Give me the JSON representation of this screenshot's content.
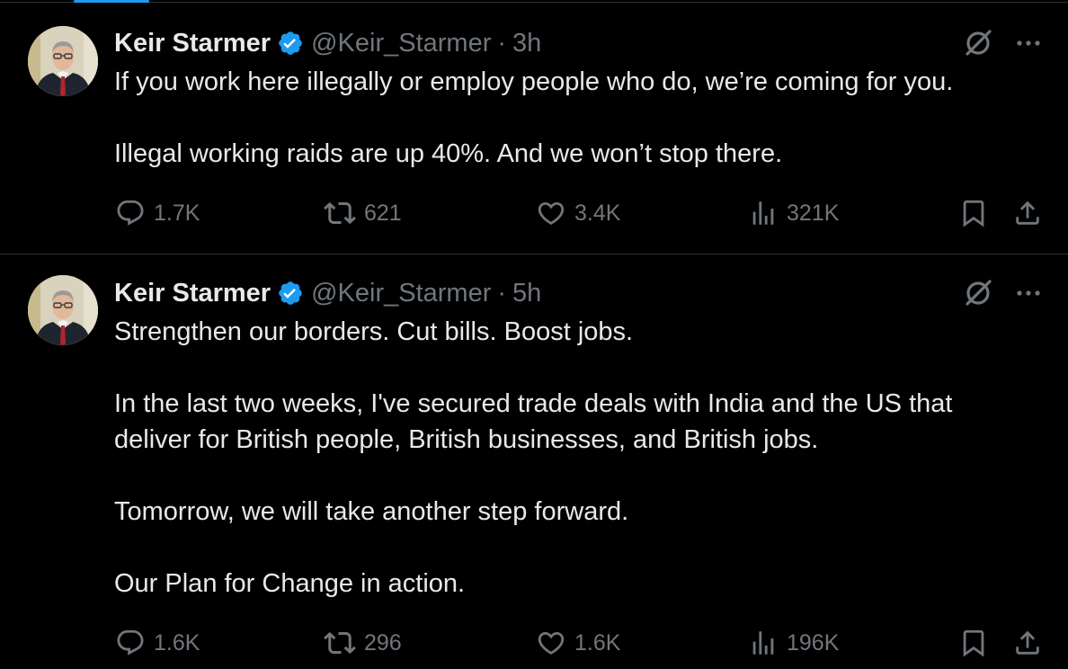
{
  "tweets": [
    {
      "author": {
        "name": "Keir Starmer",
        "handle": "@Keir_Starmer",
        "verified": true,
        "verified_color": "#1d9bf0"
      },
      "time": "3h",
      "body": [
        "If you work here illegally or employ people who do, we’re coming for you.",
        "Illegal working raids are up 40%. And we won’t stop there."
      ],
      "stats": {
        "replies": "1.7K",
        "reposts": "621",
        "likes": "3.4K",
        "views": "321K"
      }
    },
    {
      "author": {
        "name": "Keir Starmer",
        "handle": "@Keir_Starmer",
        "verified": true,
        "verified_color": "#1d9bf0"
      },
      "time": "5h",
      "body": [
        "Strengthen our borders. Cut bills. Boost jobs.",
        "In the last two weeks, I've secured trade deals with India and the US that deliver for British people, British businesses, and British jobs.",
        "Tomorrow, we will take another step forward.",
        "Our Plan for Change in action."
      ],
      "stats": {
        "replies": "1.6K",
        "reposts": "296",
        "likes": "1.6K",
        "views": "196K"
      }
    }
  ],
  "separator": "·",
  "icons": {
    "header": [
      "verified-badge-icon",
      "grok-icon",
      "more-icon"
    ],
    "actions": [
      "reply-icon",
      "repost-icon",
      "like-icon",
      "views-icon",
      "bookmark-icon",
      "share-icon"
    ]
  },
  "colors": {
    "background": "#000000",
    "text_primary": "#e7e9ea",
    "text_secondary": "#71767b",
    "divider": "#2f3336",
    "accent": "#1d9bf0"
  }
}
